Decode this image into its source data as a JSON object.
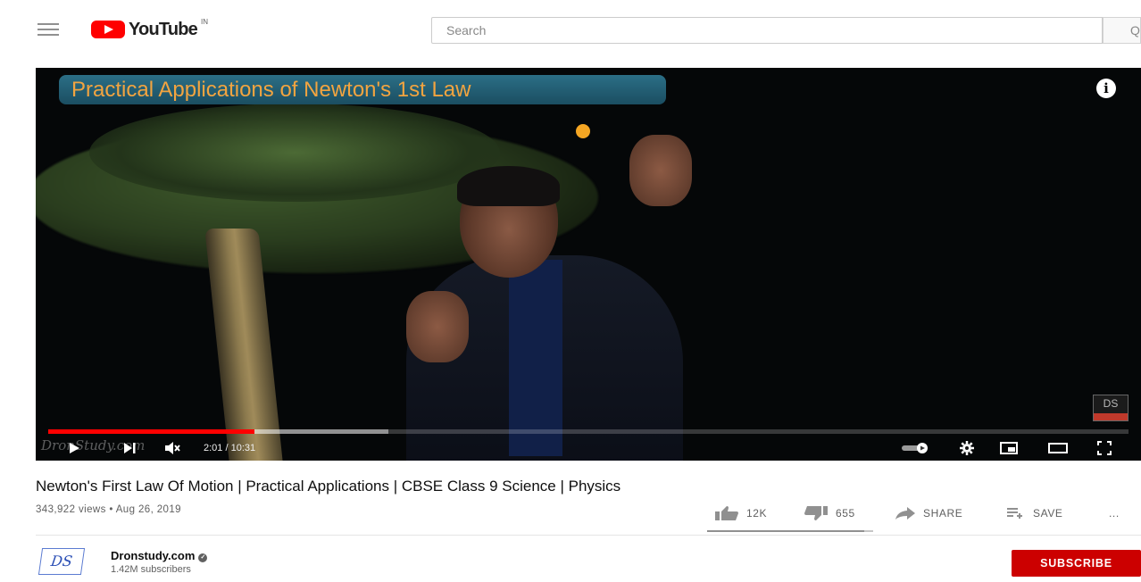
{
  "header": {
    "logo_text": "YouTube",
    "country_code": "IN",
    "search_placeholder": "Search",
    "search_button_label": "Q"
  },
  "player": {
    "title_banner": "Practical Applications of Newton's 1st Law",
    "info_icon_label": "i",
    "brand_logo_text": "DS",
    "watermark_text": "DronStudy.com",
    "current_time": "2:01",
    "duration": "10:31",
    "time_display": "2:01 / 10:31",
    "progress_fraction": 0.191,
    "buffered_fraction": 0.315,
    "controls": {
      "play": "play-icon",
      "next": "next-icon",
      "volume": "volume-muted-icon",
      "autoplay": "autoplay-toggle",
      "settings": "gear-icon",
      "miniplayer": "miniplayer-icon",
      "theater": "theater-mode-icon",
      "fullscreen": "fullscreen-icon"
    }
  },
  "video": {
    "title": "Newton's First Law Of Motion | Practical Applications | CBSE Class 9 Science | Physics",
    "views": "343,922 views",
    "separator": " • ",
    "date": "Aug 26, 2019",
    "likes": "12K",
    "dislikes": "655",
    "share_label": "SHARE",
    "save_label": "SAVE",
    "more_label": "...",
    "like_ratio": 0.948
  },
  "channel": {
    "avatar_text": "DS",
    "name": "Dronstudy.com",
    "subscribers": "1.42M subscribers",
    "subscribe_label": "SUBSCRIBE"
  },
  "colors": {
    "brand_red": "#ff0000",
    "subscribe_red": "#cc0000",
    "banner_text": "#f2a440",
    "banner_bg": "#1b4e61"
  }
}
